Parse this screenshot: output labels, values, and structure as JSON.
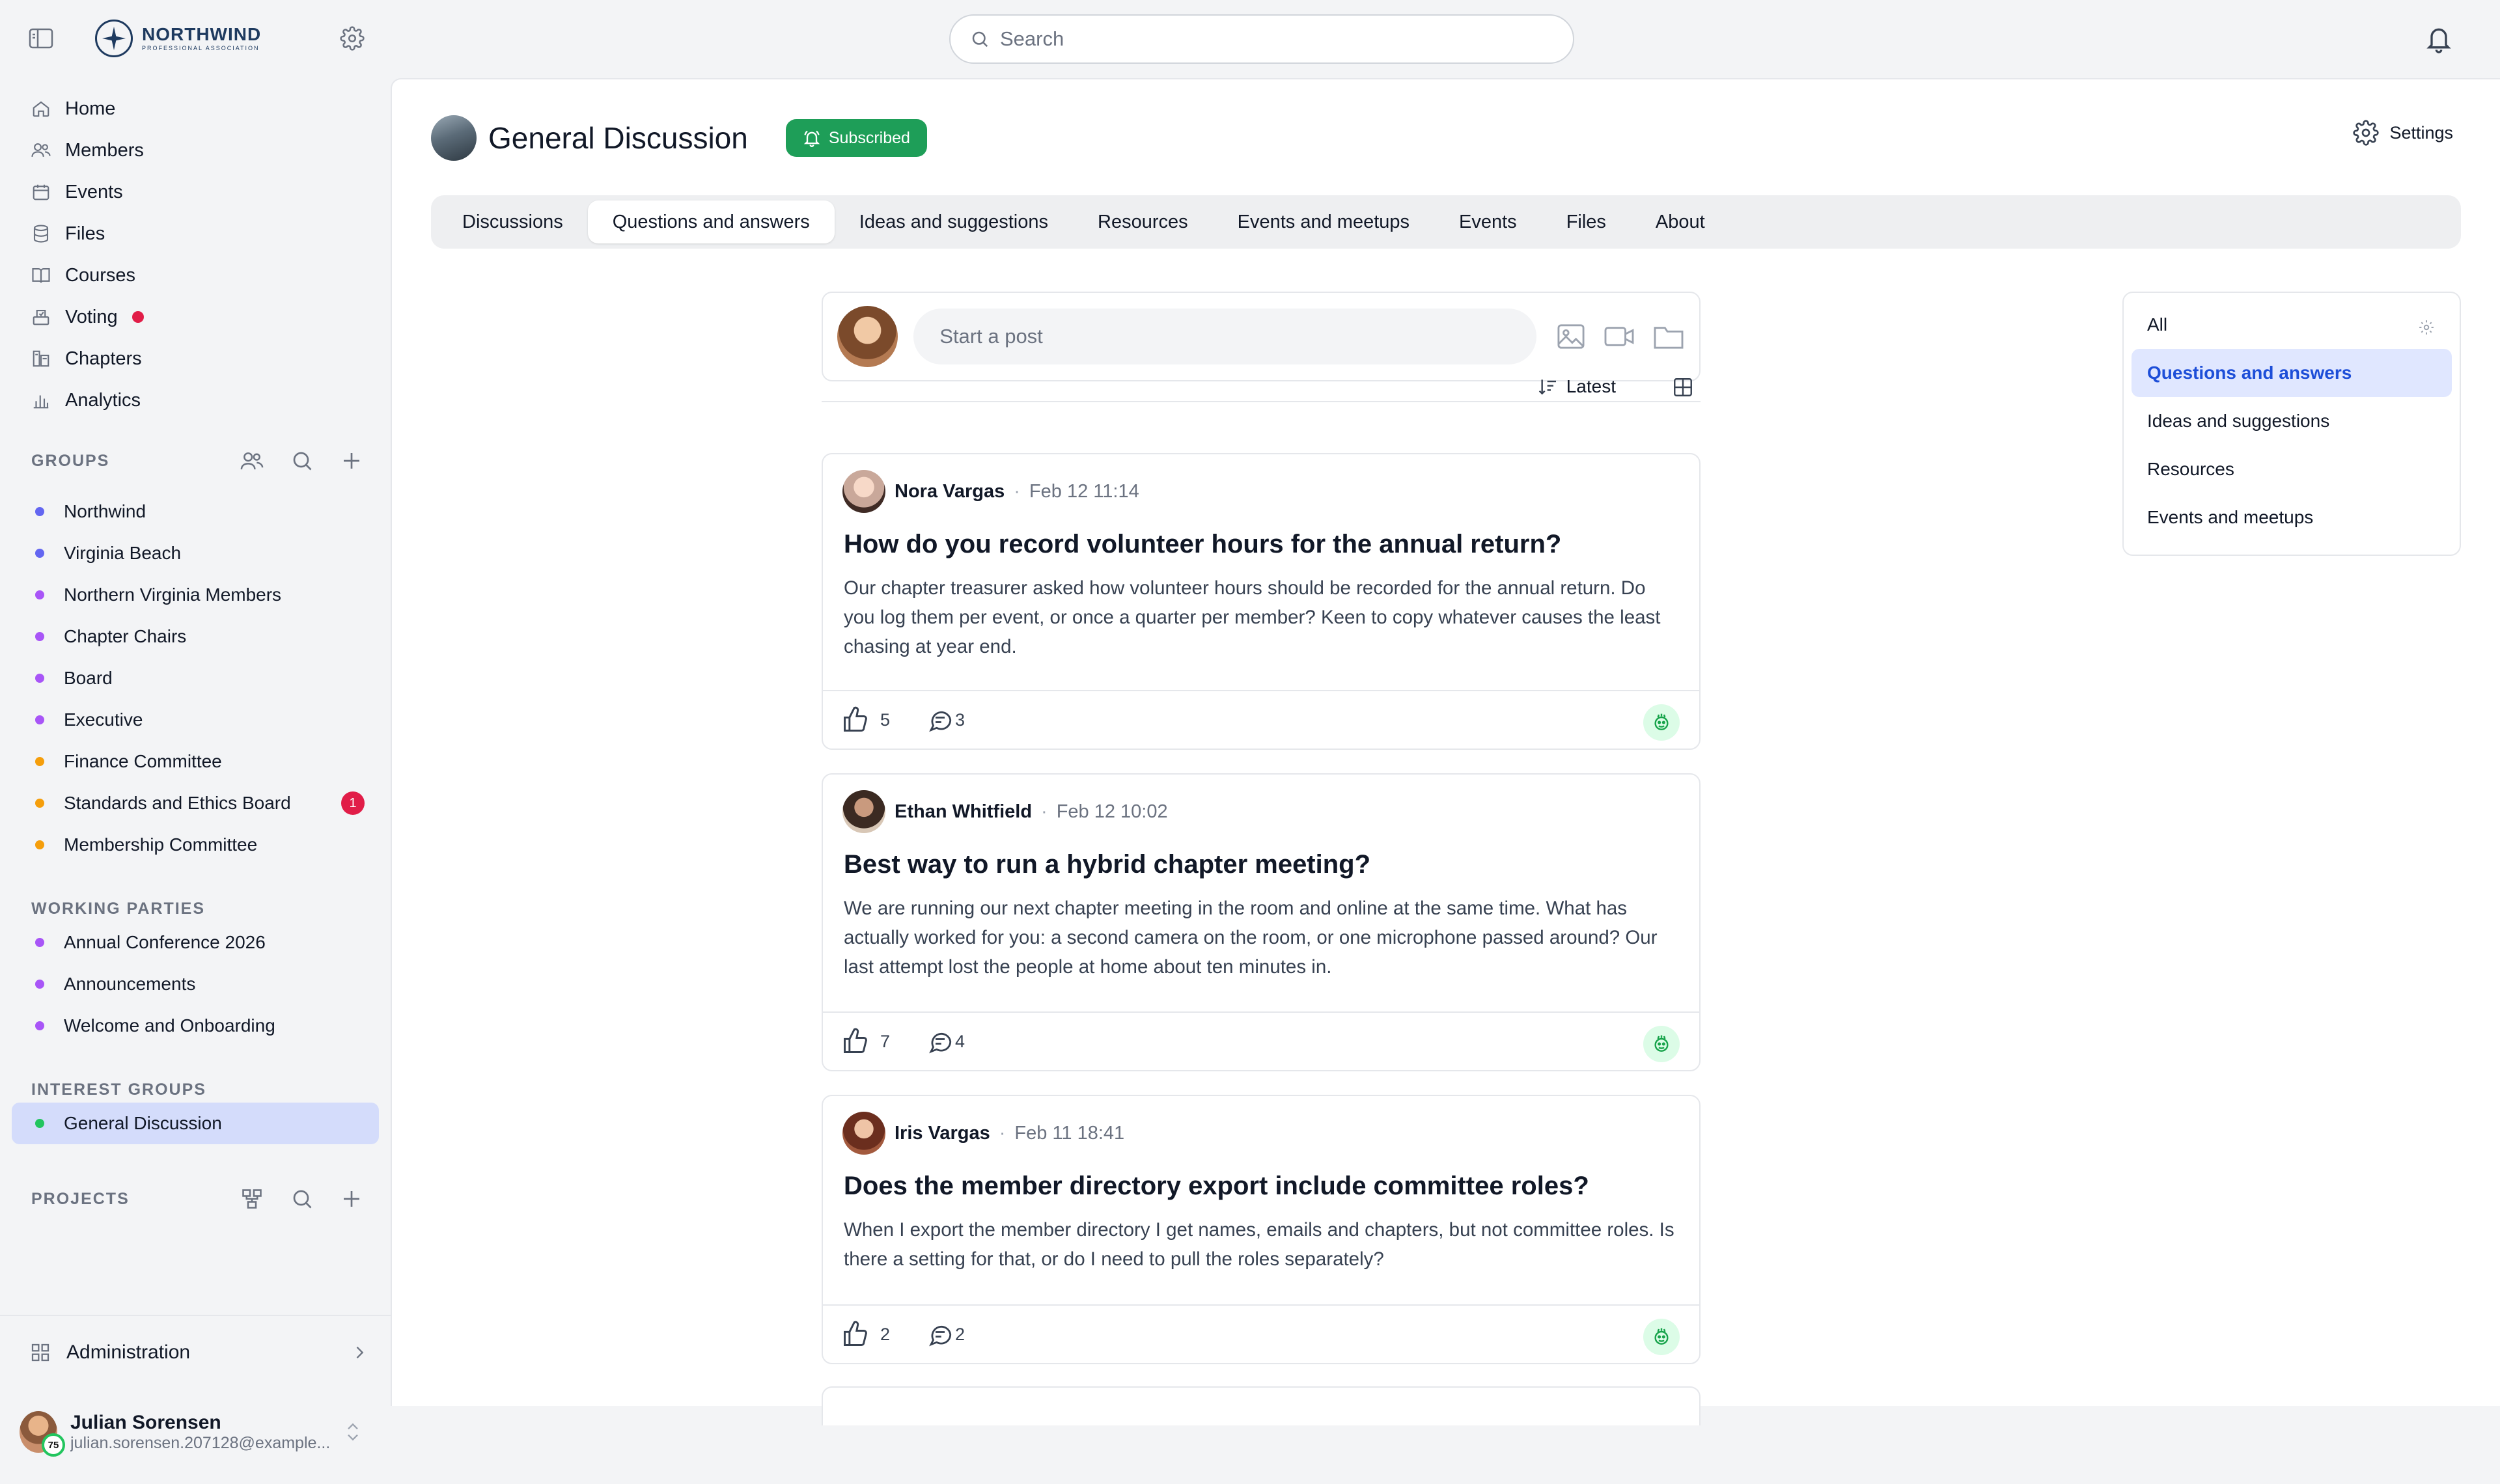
{
  "app": {
    "logo_name": "NORTHWIND",
    "logo_sub": "PROFESSIONAL ASSOCIATION"
  },
  "search": {
    "placeholder": "Search"
  },
  "nav": [
    {
      "label": "Home",
      "icon": "home-icon"
    },
    {
      "label": "Members",
      "icon": "users-icon"
    },
    {
      "label": "Events",
      "icon": "calendar-icon"
    },
    {
      "label": "Files",
      "icon": "database-icon"
    },
    {
      "label": "Courses",
      "icon": "book-icon"
    },
    {
      "label": "Voting",
      "icon": "ballot-icon"
    },
    {
      "label": "Chapters",
      "icon": "chapters-icon"
    },
    {
      "label": "Analytics",
      "icon": "chart-icon"
    }
  ],
  "groups": {
    "heading": "GROUPS",
    "items": [
      {
        "label": "Northwind",
        "color": "#6366f1"
      },
      {
        "label": "Virginia Beach",
        "color": "#6366f1"
      },
      {
        "label": "Northern Virginia Members",
        "color": "#a855f7"
      },
      {
        "label": "Chapter Chairs",
        "color": "#a855f7"
      },
      {
        "label": "Board",
        "color": "#a855f7"
      },
      {
        "label": "Executive",
        "color": "#a855f7"
      },
      {
        "label": "Finance Committee",
        "color": "#f59e0b"
      },
      {
        "label": "Standards and Ethics Board",
        "color": "#f59e0b",
        "badge": "1"
      },
      {
        "label": "Membership Committee",
        "color": "#f59e0b"
      }
    ]
  },
  "working_parties": {
    "heading": "WORKING PARTIES",
    "items": [
      {
        "label": "Annual Conference 2026",
        "color": "#a855f7"
      },
      {
        "label": "Announcements",
        "color": "#a855f7"
      },
      {
        "label": "Welcome and Onboarding",
        "color": "#a855f7"
      }
    ]
  },
  "interest_groups": {
    "heading": "INTEREST GROUPS",
    "items": [
      {
        "label": "General Discussion",
        "color": "#22c55e"
      }
    ]
  },
  "projects": {
    "heading": "PROJECTS"
  },
  "admin": {
    "label": "Administration"
  },
  "user": {
    "name": "Julian Sorensen",
    "email": "julian.sorensen.207128@example....",
    "level": "75"
  },
  "page": {
    "title": "General Discussion",
    "subscribed_label": "Subscribed",
    "settings_label": "Settings"
  },
  "tabs": [
    {
      "label": "Discussions"
    },
    {
      "label": "Questions and answers",
      "active": true
    },
    {
      "label": "Ideas and suggestions"
    },
    {
      "label": "Resources"
    },
    {
      "label": "Events and meetups"
    },
    {
      "label": "Events"
    },
    {
      "label": "Files"
    },
    {
      "label": "About"
    }
  ],
  "composer": {
    "placeholder": "Start a post"
  },
  "sort": {
    "label": "Latest"
  },
  "posts": [
    {
      "author": "Nora Vargas",
      "time": "Feb 12 11:14",
      "title": "How do you record volunteer hours for the annual return?",
      "body": "Our chapter treasurer asked how volunteer hours should be recorded for the annual return. Do you log them per event, or once a quarter per member? Keen to copy whatever causes the least chasing at year end.",
      "likes": "5",
      "comments": "3"
    },
    {
      "author": "Ethan Whitfield",
      "time": "Feb 12 10:02",
      "title": "Best way to run a hybrid chapter meeting?",
      "body": "We are running our next chapter meeting in the room and online at the same time. What has actually worked for you: a second camera on the room, or one microphone passed around? Our last attempt lost the people at home about ten minutes in.",
      "likes": "7",
      "comments": "4"
    },
    {
      "author": "Iris Vargas",
      "time": "Feb 11 18:41",
      "title": "Does the member directory export include committee roles?",
      "body": "When I export the member directory I get names, emails and chapters, but not committee roles. Is there a setting for that, or do I need to pull the roles separately?",
      "likes": "2",
      "comments": "2"
    }
  ],
  "filter_panel": {
    "items": [
      {
        "label": "All"
      },
      {
        "label": "Questions and answers",
        "active": true
      },
      {
        "label": "Ideas and suggestions"
      },
      {
        "label": "Resources"
      },
      {
        "label": "Events and meetups"
      }
    ]
  }
}
